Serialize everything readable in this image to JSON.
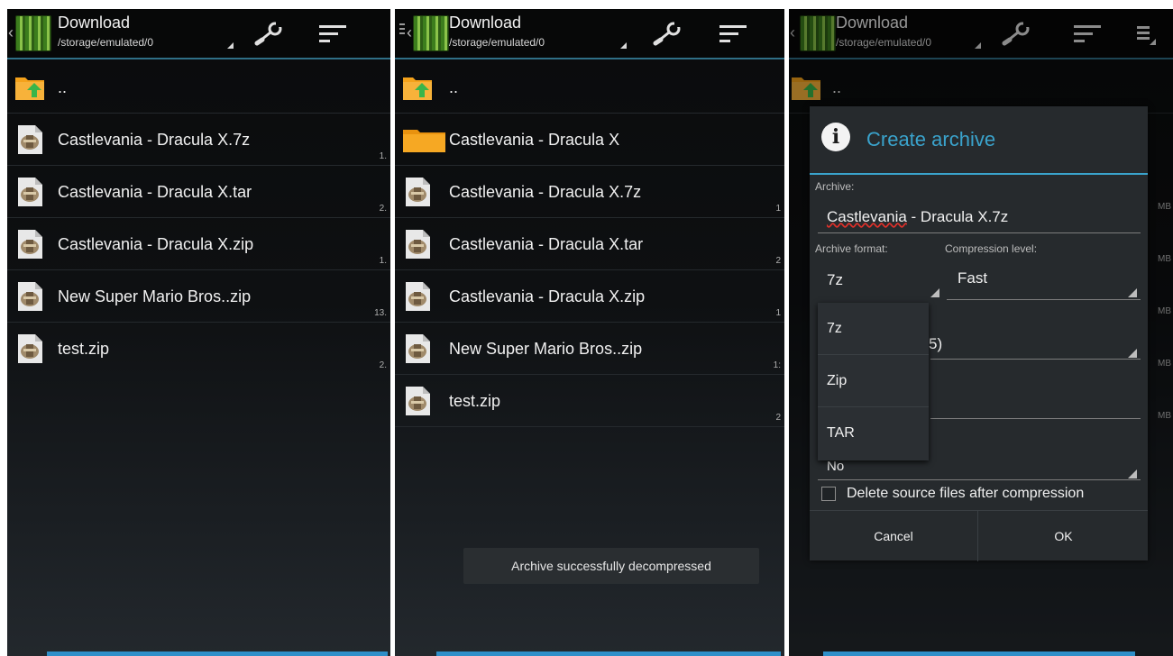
{
  "actionbar": {
    "title": "Download",
    "path": "/storage/emulated/0"
  },
  "panel1": {
    "files": [
      {
        "name": "..",
        "type": "up-folder",
        "size": ""
      },
      {
        "name": "Castlevania - Dracula X.7z",
        "type": "archive",
        "size": "1."
      },
      {
        "name": "Castlevania - Dracula X.tar",
        "type": "archive",
        "size": "2."
      },
      {
        "name": "Castlevania - Dracula X.zip",
        "type": "archive",
        "size": "1."
      },
      {
        "name": "New Super Mario Bros..zip",
        "type": "archive",
        "size": "13."
      },
      {
        "name": "test.zip",
        "type": "archive",
        "size": "2."
      }
    ]
  },
  "panel2": {
    "files": [
      {
        "name": "..",
        "type": "up-folder",
        "size": ""
      },
      {
        "name": "Castlevania - Dracula X",
        "type": "folder",
        "size": ""
      },
      {
        "name": "Castlevania - Dracula X.7z",
        "type": "archive",
        "size": "1"
      },
      {
        "name": "Castlevania - Dracula X.tar",
        "type": "archive",
        "size": "2"
      },
      {
        "name": "Castlevania - Dracula X.zip",
        "type": "archive",
        "size": "1"
      },
      {
        "name": "New Super Mario Bros..zip",
        "type": "archive",
        "size": "1:"
      },
      {
        "name": "test.zip",
        "type": "archive",
        "size": "2"
      }
    ],
    "toast": "Archive successfully decompressed"
  },
  "panel3": {
    "background_files": [
      {
        "name": "..",
        "type": "up-folder",
        "size": ""
      }
    ],
    "dialog": {
      "title": "Create archive",
      "archive_label": "Archive:",
      "archive_name_word": "Castlevania",
      "archive_name_rest": " - Dracula X.7z",
      "format_label": "Archive format:",
      "format_value": "7z",
      "compression_label": "Compression level:",
      "compression_value": "Fast",
      "hidden_value_fragment": "5)",
      "encrypt_value": "No",
      "delete_label": "Delete source files after compression",
      "delete_checked": false,
      "format_options": [
        "7z",
        "Zip",
        "TAR"
      ],
      "cancel_label": "Cancel",
      "ok_label": "OK"
    },
    "bg_size_labels": [
      "MB",
      "MB",
      "MB",
      "MB",
      "MB"
    ]
  },
  "colors": {
    "accent": "#3aa3cc",
    "bottom_bar": "#2f8fc9",
    "folder": "#f4a21b"
  }
}
